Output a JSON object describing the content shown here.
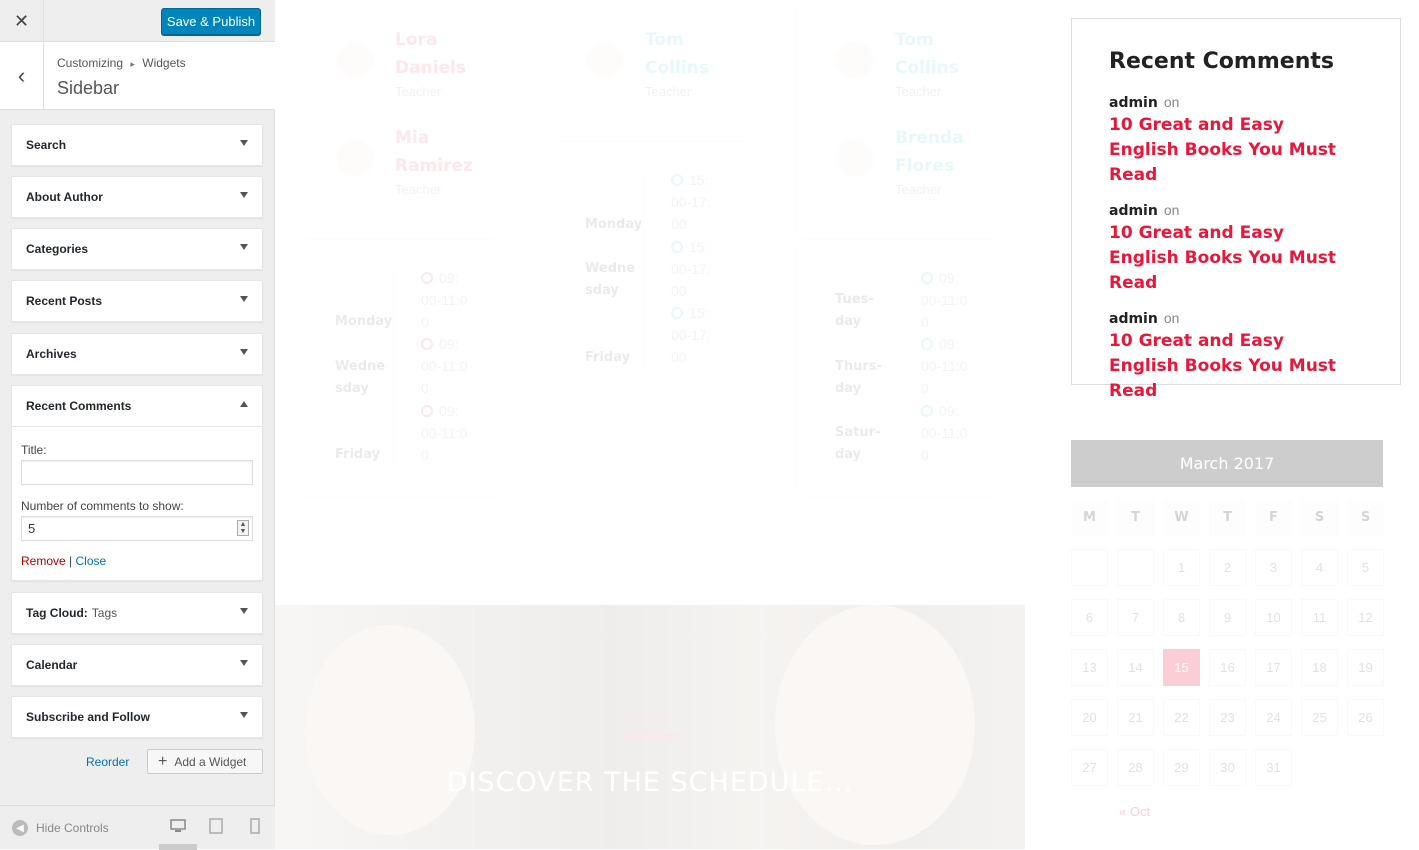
{
  "customizer": {
    "close_glyph": "✕",
    "save_label": "Save & Publish",
    "back_glyph": "‹",
    "breadcrumb_parent": "Customizing",
    "breadcrumb_sep": "▸",
    "breadcrumb_child": "Widgets",
    "section_title": "Sidebar",
    "widgets": [
      {
        "title": "Search"
      },
      {
        "title": "About Author"
      },
      {
        "title": "Categories"
      },
      {
        "title": "Recent Posts"
      },
      {
        "title": "Archives"
      },
      {
        "title": "Recent Comments"
      },
      {
        "title": "Tag Cloud:",
        "subtitle": "Tags"
      },
      {
        "title": "Calendar"
      },
      {
        "title": "Subscribe and Follow"
      }
    ],
    "expanded_widget": {
      "title_label": "Title:",
      "title_value": "",
      "count_label": "Number of comments to show:",
      "count_value": "5",
      "remove_label": "Remove",
      "separator": "|",
      "close_label": "Close"
    },
    "reorder_label": "Reorder",
    "add_widget_label": "Add a Widget",
    "hide_controls_label": "Hide Controls",
    "devices": [
      "desktop-icon",
      "tablet-icon",
      "mobile-icon"
    ],
    "active_device": "desktop"
  },
  "preview": {
    "teachers": [
      {
        "name": "Lora Daniels",
        "role": "Teacher",
        "color": "pink"
      },
      {
        "name": "Mia Ramirez",
        "role": "Teacher",
        "color": "pink"
      },
      {
        "name": "Tom Collins",
        "role": "Teacher",
        "color": "teal"
      },
      {
        "name": "Tom Collins",
        "role": "Teacher",
        "color": "teal"
      },
      {
        "name": "Brenda Flores",
        "role": "Teacher",
        "color": "teal"
      }
    ],
    "schedule_1": {
      "days": [
        "Monday",
        "Wedne sday",
        "Friday"
      ],
      "times": [
        "09: 00-11:0 0",
        "09: 00-11:0 0",
        "09: 00-11:0 0"
      ]
    },
    "schedule_2": {
      "days": [
        "Monday",
        "Wedne sday",
        "Friday"
      ],
      "times": [
        "15: 00-17: 00",
        "15: 00-17: 00",
        "15: 00-17: 00"
      ]
    },
    "schedule_3": {
      "days": [
        "Tues- day",
        "Thurs- day",
        "Satur- day"
      ],
      "times": [
        "09: 00-11:0 0",
        "09: 00-11:0 0",
        "09: 00-11:0 0"
      ]
    },
    "hero_title": "DISCOVER THE SCHEDULE...",
    "recent_comments": {
      "heading": "Recent Comments",
      "items": [
        {
          "author": "admin",
          "on": "on",
          "post": "10 Great and Easy English Books You Must Read"
        },
        {
          "author": "admin",
          "on": "on",
          "post": "10 Great and Easy English Books You Must Read"
        },
        {
          "author": "admin",
          "on": "on",
          "post": "10 Great and Easy English Books You Must Read"
        }
      ]
    },
    "calendar": {
      "caption": "March 2017",
      "weekdays": [
        "M",
        "T",
        "W",
        "T",
        "F",
        "S",
        "S"
      ],
      "leading_empty": 2,
      "days": [
        "1",
        "2",
        "3",
        "4",
        "5",
        "6",
        "7",
        "8",
        "9",
        "10",
        "11",
        "12",
        "13",
        "14",
        "15",
        "16",
        "17",
        "18",
        "19",
        "20",
        "21",
        "22",
        "23",
        "24",
        "25",
        "26",
        "27",
        "28",
        "29",
        "30",
        "31"
      ],
      "today": "15",
      "prev_link": "« Oct"
    },
    "colors": {
      "accent_pink": "#ef3c5e",
      "accent_teal": "#3cc5d6",
      "comment_link": "#e8173b",
      "wp_blue": "#0085ba"
    }
  }
}
